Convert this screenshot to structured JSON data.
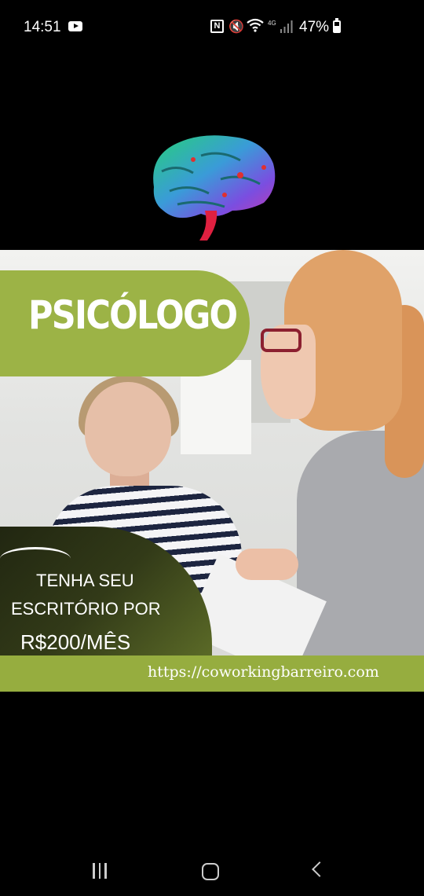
{
  "status_bar": {
    "time": "14:51",
    "network": "4G",
    "battery": "47%",
    "icons": [
      "youtube-icon",
      "nfc-icon",
      "mute-icon",
      "wifi-icon",
      "signal-icon",
      "battery-icon"
    ]
  },
  "ad": {
    "title": "PSICÓLOGO",
    "offer_line1": "TENHA SEU",
    "offer_line2": "ESCRITÓRIO POR",
    "offer_line3": "R$200/MÊS",
    "url": "https://coworkingbarreiro.com"
  },
  "colors": {
    "accent_green": "#9cb346",
    "background": "#000000"
  },
  "nav_bar": {
    "icons": [
      "recent-apps-icon",
      "home-icon",
      "back-icon"
    ]
  }
}
